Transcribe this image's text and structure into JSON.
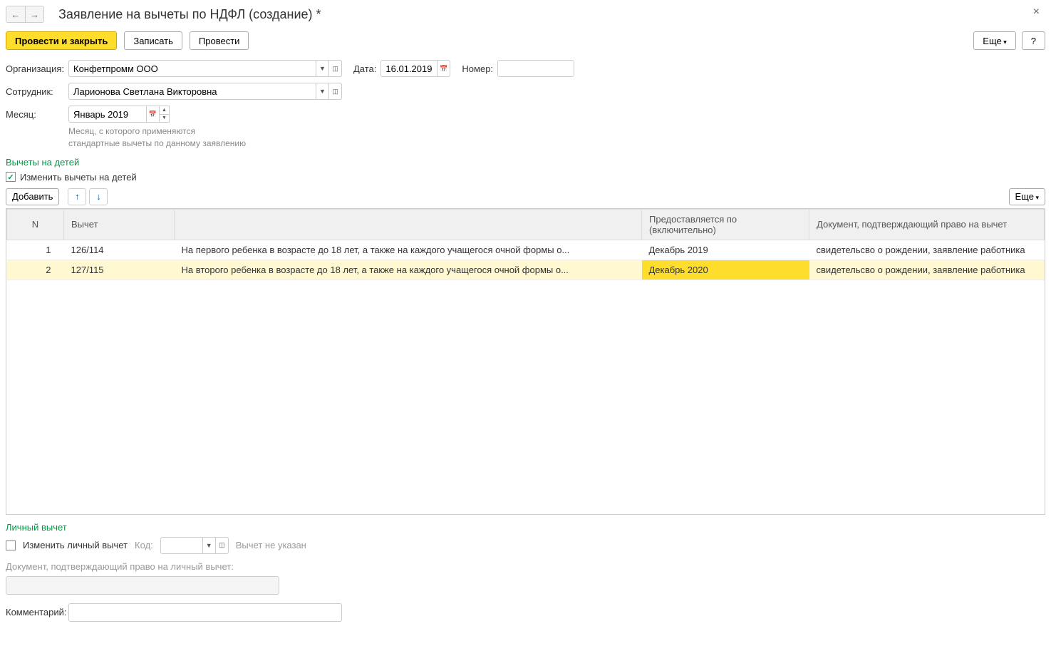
{
  "header": {
    "title": "Заявление на вычеты по НДФЛ (создание) *"
  },
  "toolbar": {
    "post_close": "Провести и закрыть",
    "write": "Записать",
    "post": "Провести",
    "more": "Еще",
    "help": "?"
  },
  "form": {
    "org_label": "Организация:",
    "org_value": "Конфетпромм ООО",
    "date_label": "Дата:",
    "date_value": "16.01.2019",
    "number_label": "Номер:",
    "number_value": "",
    "employee_label": "Сотрудник:",
    "employee_value": "Ларионова Светлана Викторовна",
    "month_label": "Месяц:",
    "month_value": "Январь 2019",
    "month_hint_l1": "Месяц, с которого применяются",
    "month_hint_l2": "стандартные вычеты по данному заявлению"
  },
  "children": {
    "section_title": "Вычеты на детей",
    "change_label": "Изменить вычеты на детей",
    "add_btn": "Добавить",
    "more_btn": "Еще",
    "columns": {
      "n": "N",
      "deduction": "Вычет",
      "desc": "",
      "until": "Предоставляется по (включительно)",
      "doc": "Документ, подтверждающий право на вычет"
    },
    "rows": [
      {
        "n": "1",
        "code": "126/114",
        "desc": "На первого ребенка в возрасте до 18 лет, а также на каждого учащегося очной формы о...",
        "until": "Декабрь 2019",
        "doc": "свидетельсво о рождении, заявление работника"
      },
      {
        "n": "2",
        "code": "127/115",
        "desc": "На второго ребенка в возрасте до 18 лет, а также на каждого учащегося очной формы о...",
        "until": "Декабрь 2020",
        "doc": "свидетельсво о рождении, заявление работника"
      }
    ]
  },
  "personal": {
    "section_title": "Личный вычет",
    "change_label": "Изменить личный вычет",
    "code_label": "Код:",
    "code_value": "",
    "not_set": "Вычет не указан",
    "doc_label": "Документ, подтверждающий право на личный вычет:",
    "doc_value": "",
    "comment_label": "Комментарий:",
    "comment_value": ""
  }
}
